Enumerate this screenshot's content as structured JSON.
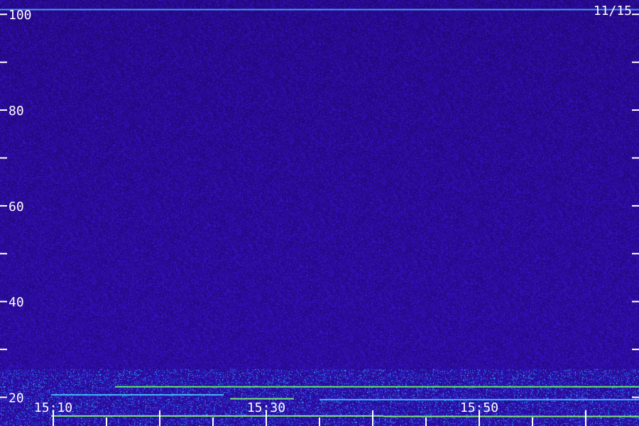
{
  "chart_data": {
    "type": "heatmap",
    "date": "11/15",
    "y_tick_labels": [
      "100",
      "80",
      "60",
      "40",
      "20"
    ],
    "y_tick_values": [
      100,
      80,
      60,
      40,
      20
    ],
    "y_minor_tick_values": [
      90,
      70,
      50,
      30
    ],
    "ylim": [
      14,
      103
    ],
    "x_tick_labels": [
      "15:10",
      "15:30",
      "15:50"
    ],
    "x_tick_values": [
      "15:10",
      "15:30",
      "15:50"
    ],
    "xlim": [
      "15:05",
      "15:65"
    ],
    "bands": [
      {
        "y": 101,
        "color": "#4aa8ff",
        "extent": [
          0,
          1
        ]
      },
      {
        "y": 22.2,
        "color": "#66ff66",
        "extent": [
          0.18,
          1
        ]
      },
      {
        "y": 20.5,
        "color": "#46c8ff",
        "extent": [
          0.08,
          0.35
        ]
      },
      {
        "y": 19.7,
        "color": "#7cff70",
        "extent": [
          0.36,
          0.46
        ]
      },
      {
        "y": 19.5,
        "color": "#46c8ff",
        "extent": [
          0.5,
          1
        ]
      },
      {
        "y": 16.1,
        "color": "#8cff70",
        "extent": [
          0.08,
          0.6
        ]
      },
      {
        "y": 16.0,
        "color": "#8cff70",
        "extent": [
          0.6,
          1
        ]
      }
    ],
    "colors": {
      "background_low": "#0c0340",
      "background_mid": "#3a1ad0",
      "foreground": "#ffffff"
    },
    "grid": false
  }
}
